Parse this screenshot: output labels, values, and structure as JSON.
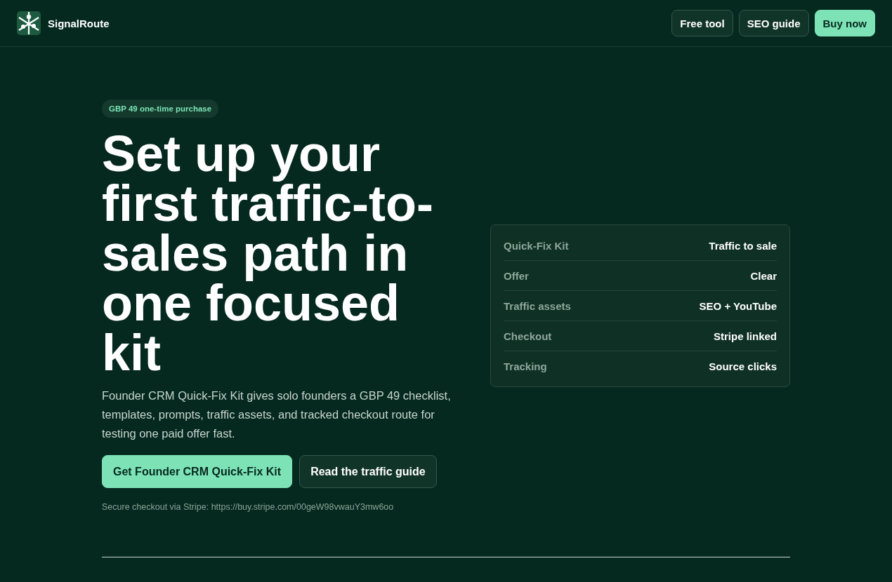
{
  "header": {
    "brand": "SignalRoute",
    "nav": [
      {
        "label": "Free tool",
        "kind": "outline"
      },
      {
        "label": "SEO guide",
        "kind": "outline"
      },
      {
        "label": "Buy now",
        "kind": "primary"
      }
    ]
  },
  "hero": {
    "badge": "GBP 49 one-time purchase",
    "title": "Set up your first traffic-to-sales path in one focused kit",
    "description": "Founder CRM Quick-Fix Kit gives solo founders a GBP 49 checklist, templates, prompts, traffic assets, and tracked checkout route for testing one paid offer fast.",
    "buttons": [
      {
        "label": "Get Founder CRM Quick-Fix Kit",
        "kind": "primary"
      },
      {
        "label": "Read the traffic guide",
        "kind": "outline"
      }
    ],
    "note": "Secure checkout via Stripe: https://buy.stripe.com/00geW98vwauY3mw6oo"
  },
  "summary_card": {
    "rows": [
      {
        "label": "Quick-Fix Kit",
        "value": "Traffic to sale"
      },
      {
        "label": "Offer",
        "value": "Clear"
      },
      {
        "label": "Traffic assets",
        "value": "SEO + YouTube"
      },
      {
        "label": "Checkout",
        "value": "Stripe linked"
      },
      {
        "label": "Tracking",
        "value": "Source clicks"
      }
    ]
  }
}
